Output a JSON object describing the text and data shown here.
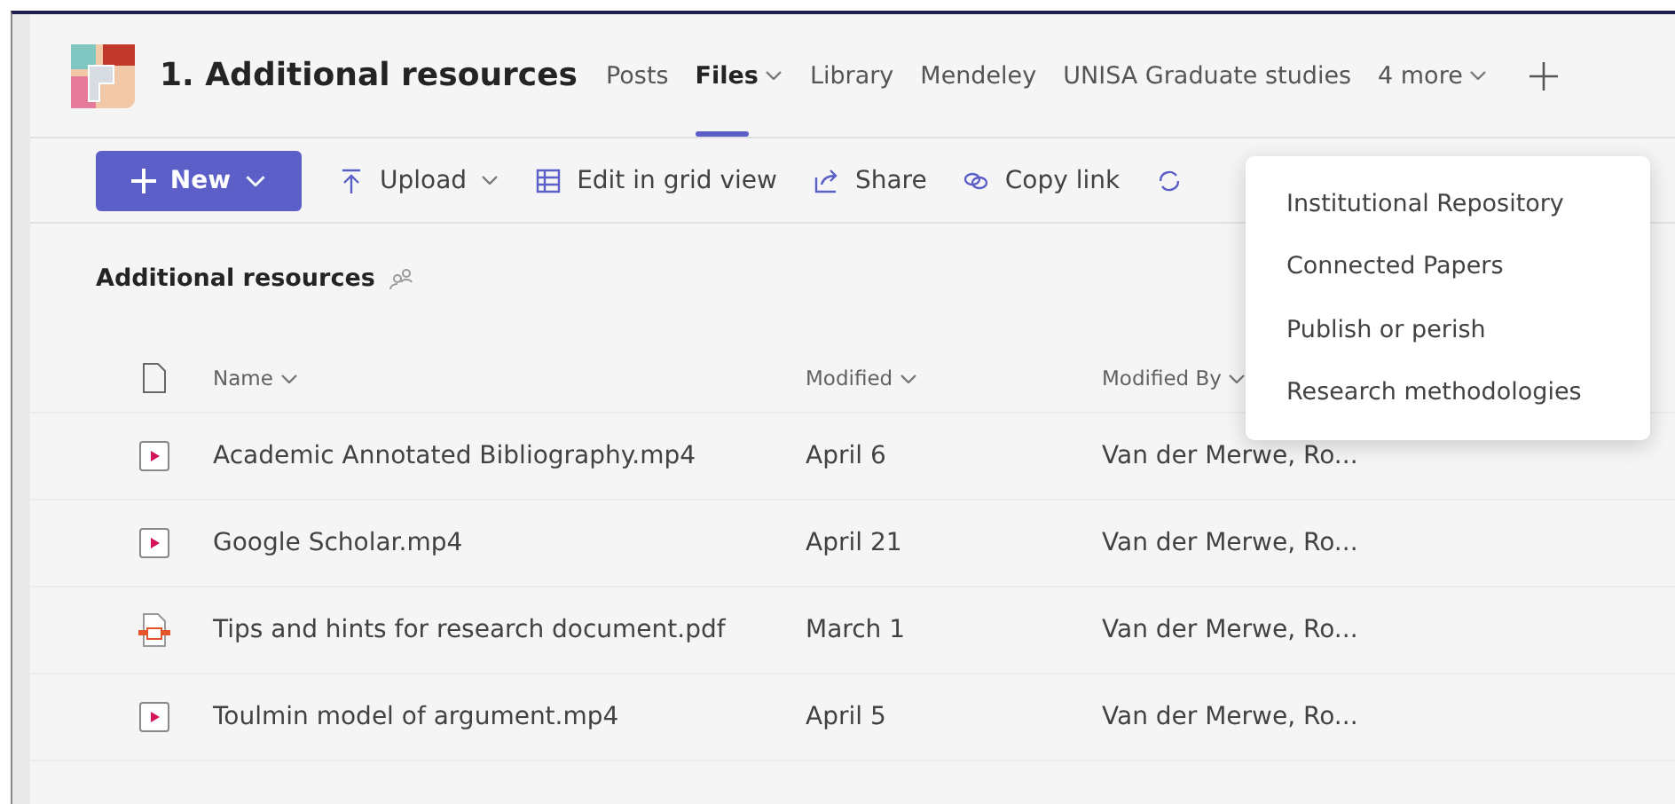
{
  "header": {
    "title": "1. Additional resources"
  },
  "tabs": [
    {
      "label": "Posts",
      "selected": false,
      "dropdown": false
    },
    {
      "label": "Files",
      "selected": true,
      "dropdown": true
    },
    {
      "label": "Library",
      "selected": false,
      "dropdown": false
    },
    {
      "label": "Mendeley",
      "selected": false,
      "dropdown": false
    },
    {
      "label": "UNISA Graduate studies",
      "selected": false,
      "dropdown": false
    },
    {
      "label": "4 more",
      "selected": false,
      "dropdown": true
    }
  ],
  "toolbar": {
    "new_button": "New",
    "actions": [
      {
        "kind": "upload",
        "label": "Upload"
      },
      {
        "kind": "grid",
        "label": "Edit in grid view"
      },
      {
        "kind": "share",
        "label": "Share"
      },
      {
        "kind": "link",
        "label": "Copy link"
      },
      {
        "kind": "sync"
      }
    ]
  },
  "breadcrumb": "Additional resources",
  "table": {
    "columns": [
      "Name",
      "Modified",
      "Modified By"
    ],
    "rows": [
      {
        "kind": "video",
        "name": "Academic Annotated Bibliography.mp4",
        "modified": "April 6",
        "modified_by": "Van der Merwe, Ro..."
      },
      {
        "kind": "video",
        "name": "Google Scholar.mp4",
        "modified": "April 21",
        "modified_by": "Van der Merwe, Ro..."
      },
      {
        "kind": "pdf",
        "name": "Tips and hints for research document.pdf",
        "modified": "March 1",
        "modified_by": "Van der Merwe, Ro..."
      },
      {
        "kind": "video",
        "name": "Toulmin model of argument.mp4",
        "modified": "April 5",
        "modified_by": "Van der Merwe, Ro..."
      }
    ]
  },
  "more_menu": {
    "items": [
      "Institutional Repository",
      "Connected Papers",
      "Publish or perish",
      "Research methodologies"
    ]
  }
}
